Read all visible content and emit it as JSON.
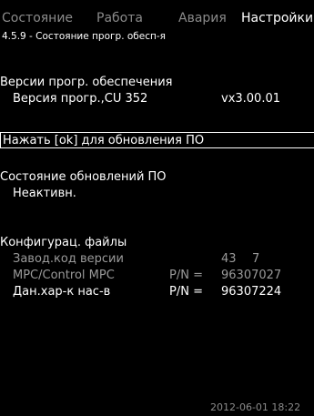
{
  "tabs": [
    {
      "label": "Состояние",
      "active": false
    },
    {
      "label": "Работа",
      "active": false
    },
    {
      "label": "Авария",
      "active": false
    },
    {
      "label": "Настройки",
      "active": true
    }
  ],
  "breadcrumb": "4.5.9 - Состояние прогр. обесп-я",
  "software_versions": {
    "heading": "Версии прогр. обеспечения",
    "row_label": "Версия прогр.,CU 352",
    "row_value": "vx3.00.01"
  },
  "update_button": "Нажать [ok] для обновления ПО",
  "update_status": {
    "heading": "Состояние обновлений ПО",
    "value": "Неактивн."
  },
  "config_files": {
    "heading": "Конфигурац. файлы",
    "rows": [
      {
        "label": "Завод.код версии",
        "pn": "",
        "value1": "43",
        "value2": "7"
      },
      {
        "label": "MPC/Control MPC",
        "pn": "P/N =",
        "value1": "96307027",
        "value2": ""
      },
      {
        "label": "Дан.хар-к нас-в",
        "pn": "P/N =",
        "value1": "96307224",
        "value2": ""
      }
    ]
  },
  "footer": {
    "datetime": "2012-06-01 18:22"
  },
  "colors": {
    "background": "#000000",
    "text": "#ffffff",
    "inactive": "#8a8a8a"
  }
}
